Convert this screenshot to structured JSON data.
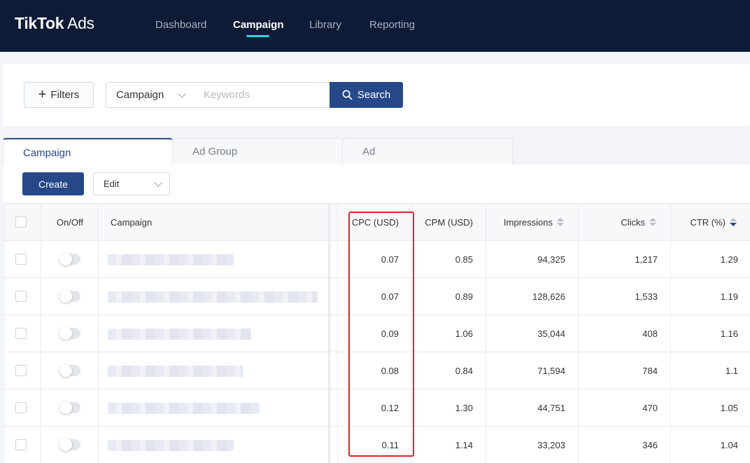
{
  "app": {
    "logo_bold": "TikTok",
    "logo_light": " Ads"
  },
  "nav": {
    "items": [
      {
        "label": "Dashboard",
        "active": false
      },
      {
        "label": "Campaign",
        "active": true
      },
      {
        "label": "Library",
        "active": false
      },
      {
        "label": "Reporting",
        "active": false
      }
    ]
  },
  "filters": {
    "filters_label": "Filters",
    "scope_select": "Campaign",
    "keyword_placeholder": "Keywords",
    "search_label": "Search"
  },
  "tabs": [
    {
      "label": "Campaign",
      "active": true
    },
    {
      "label": "Ad Group",
      "active": false
    },
    {
      "label": "Ad",
      "active": false
    }
  ],
  "toolbar": {
    "create_label": "Create",
    "edit_label": "Edit"
  },
  "table": {
    "columns": {
      "onoff": "On/Off",
      "campaign": "Campaign",
      "cpc": "CPC (USD)",
      "cpm": "CPM (USD)",
      "impressions": "Impressions",
      "clicks": "Clicks",
      "ctr": "CTR (%)"
    },
    "sorted_column": "ctr",
    "sort_direction": "descending",
    "highlighted_column": "cpc",
    "highlight_color": "#e0222b",
    "accent_color": "#264788",
    "rows": [
      {
        "cpc": "0.07",
        "cpm": "0.85",
        "impressions": "94,325",
        "clicks": "1,217",
        "ctr": "1.29"
      },
      {
        "cpc": "0.07",
        "cpm": "0.89",
        "impressions": "128,626",
        "clicks": "1,533",
        "ctr": "1.19"
      },
      {
        "cpc": "0.09",
        "cpm": "1.06",
        "impressions": "35,044",
        "clicks": "408",
        "ctr": "1.16"
      },
      {
        "cpc": "0.08",
        "cpm": "0.84",
        "impressions": "71,594",
        "clicks": "784",
        "ctr": "1.1"
      },
      {
        "cpc": "0.12",
        "cpm": "1.30",
        "impressions": "44,751",
        "clicks": "470",
        "ctr": "1.05"
      },
      {
        "cpc": "0.11",
        "cpm": "1.14",
        "impressions": "33,203",
        "clicks": "346",
        "ctr": "1.04"
      }
    ]
  }
}
